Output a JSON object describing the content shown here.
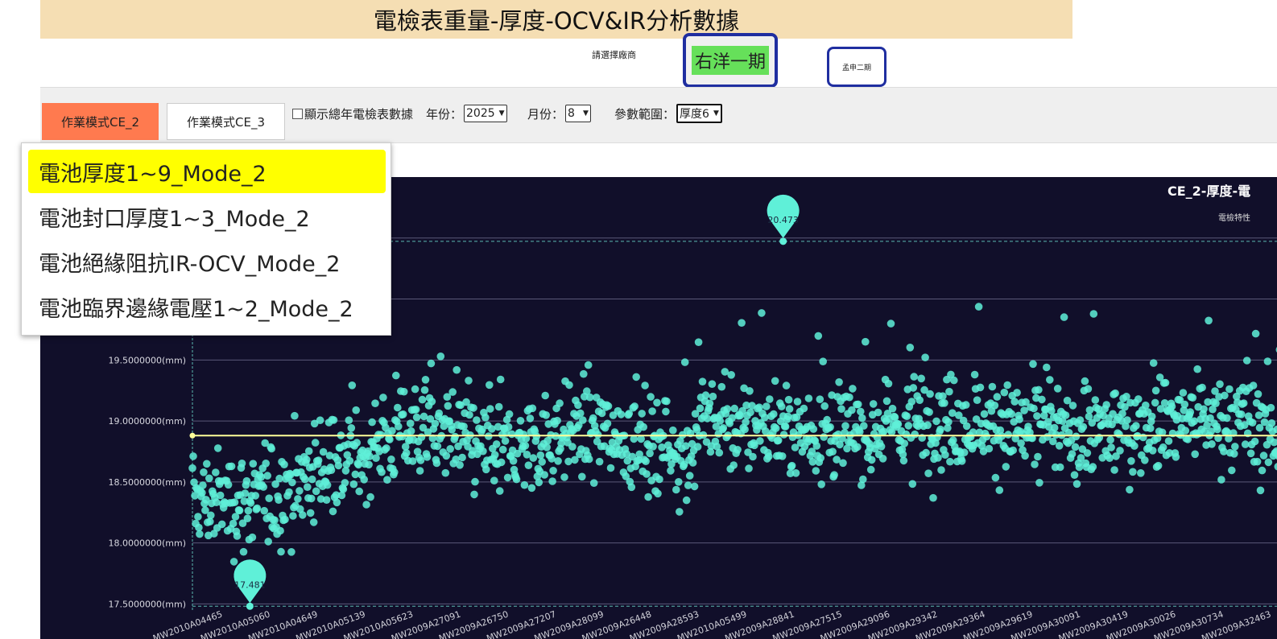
{
  "header": {
    "title": "電檢表重量-厚度-OCV&IR分析數據"
  },
  "factory": {
    "label": "請選擇廠商",
    "buttons": [
      "右洋一期",
      "孟申二期"
    ]
  },
  "toolbar": {
    "mode_buttons": [
      "作業模式CE_2",
      "作業模式CE_3"
    ],
    "show_all_label": "顯示總年電檢表數據",
    "year_label": "年份：",
    "year_value": "2025",
    "month_label": "月份：",
    "month_value": "8",
    "param_label": "參數範圍：",
    "param_value": "厚度6"
  },
  "menu": {
    "items": [
      "電池厚度1~9_Mode_2",
      "電池封口厚度1~3_Mode_2",
      "電池絕緣阻抗IR-OCV_Mode_2",
      "電池臨界邊緣電壓1~2_Mode_2"
    ]
  },
  "colors": {
    "point": "#5ff0d8",
    "chart_bg": "#110f2a",
    "mean_line": "#ffff99",
    "highlight": "#ffff00",
    "active_button": "#ff7a4f"
  },
  "chart_data": {
    "type": "scatter",
    "title": "CE_2-厚度-電",
    "subtitle": "電檢特性",
    "ytick_labels": [
      "17.5000000(mm)",
      "18.0000000(mm)",
      "18.5000000(mm)",
      "19.0000000(mm)",
      "19.5000000(mm)"
    ],
    "ylim": [
      17.45,
      21.0
    ],
    "mean": 18.88,
    "max_marker": {
      "label": "20.473",
      "value": 20.473,
      "category_index": 740
    },
    "min_marker": {
      "label": "17.481",
      "value": 17.481,
      "category_index": 72
    },
    "n_points": 1400,
    "categories": [
      "MW2010A04465",
      "MW2010A05060",
      "MW2010A04649",
      "MW2010A05139",
      "MW2010A05623",
      "MW2009A27091",
      "MW2009A26750",
      "MW2009A27207",
      "MW2009A28099",
      "MW2009A26448",
      "MW2009A28593",
      "MW2010A05499",
      "MW2009A28841",
      "MW2009A27515",
      "MW2009A29096",
      "MW2009A29342",
      "MW2009A29364",
      "MW2009A29619",
      "MW2009A30091",
      "MW2009A30419",
      "MW2009A30026",
      "MW2009A30734",
      "MW2009A32463"
    ],
    "grid": true
  }
}
